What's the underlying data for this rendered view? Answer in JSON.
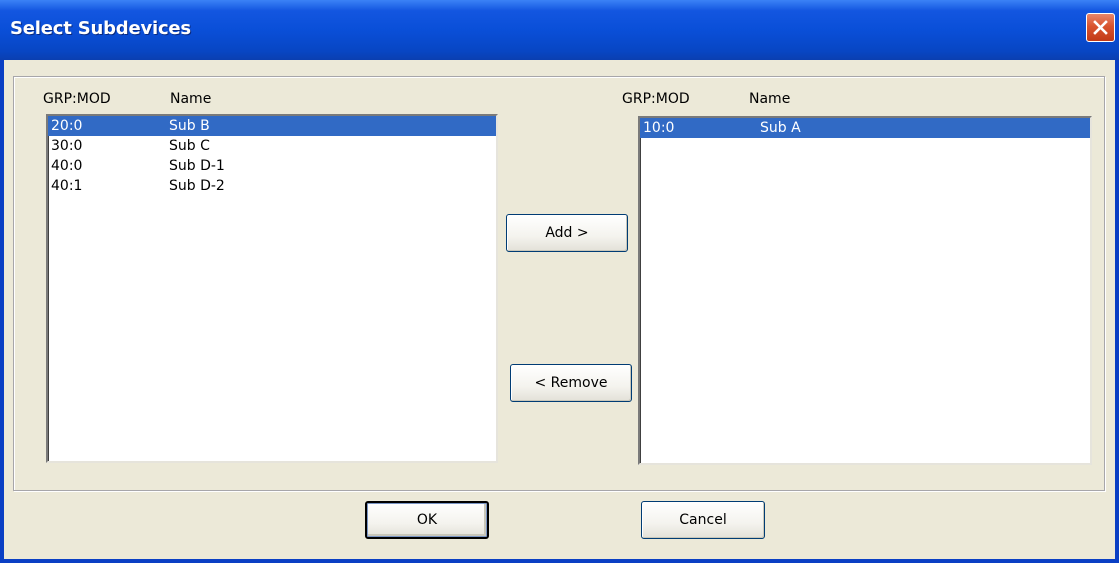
{
  "window": {
    "title": "Select Subdevices"
  },
  "left_list": {
    "headers": {
      "grp": "GRP:MOD",
      "name": "Name"
    },
    "rows": [
      {
        "grp": "20:0",
        "name": "Sub B",
        "selected": true
      },
      {
        "grp": "30:0",
        "name": "Sub C",
        "selected": false
      },
      {
        "grp": "40:0",
        "name": "Sub D-1",
        "selected": false
      },
      {
        "grp": "40:1",
        "name": "Sub D-2",
        "selected": false
      }
    ]
  },
  "right_list": {
    "headers": {
      "grp": "GRP:MOD",
      "name": "Name"
    },
    "rows": [
      {
        "grp": "10:0",
        "name": "Sub A",
        "selected": true
      }
    ]
  },
  "buttons": {
    "add": "Add >",
    "remove": "< Remove",
    "ok": "OK",
    "cancel": "Cancel"
  },
  "icons": {
    "close": "close-icon"
  },
  "colors": {
    "selection": "#316ac5",
    "titlebar": "#0a4fd8",
    "close": "#d9542f",
    "face": "#ece9d8"
  }
}
